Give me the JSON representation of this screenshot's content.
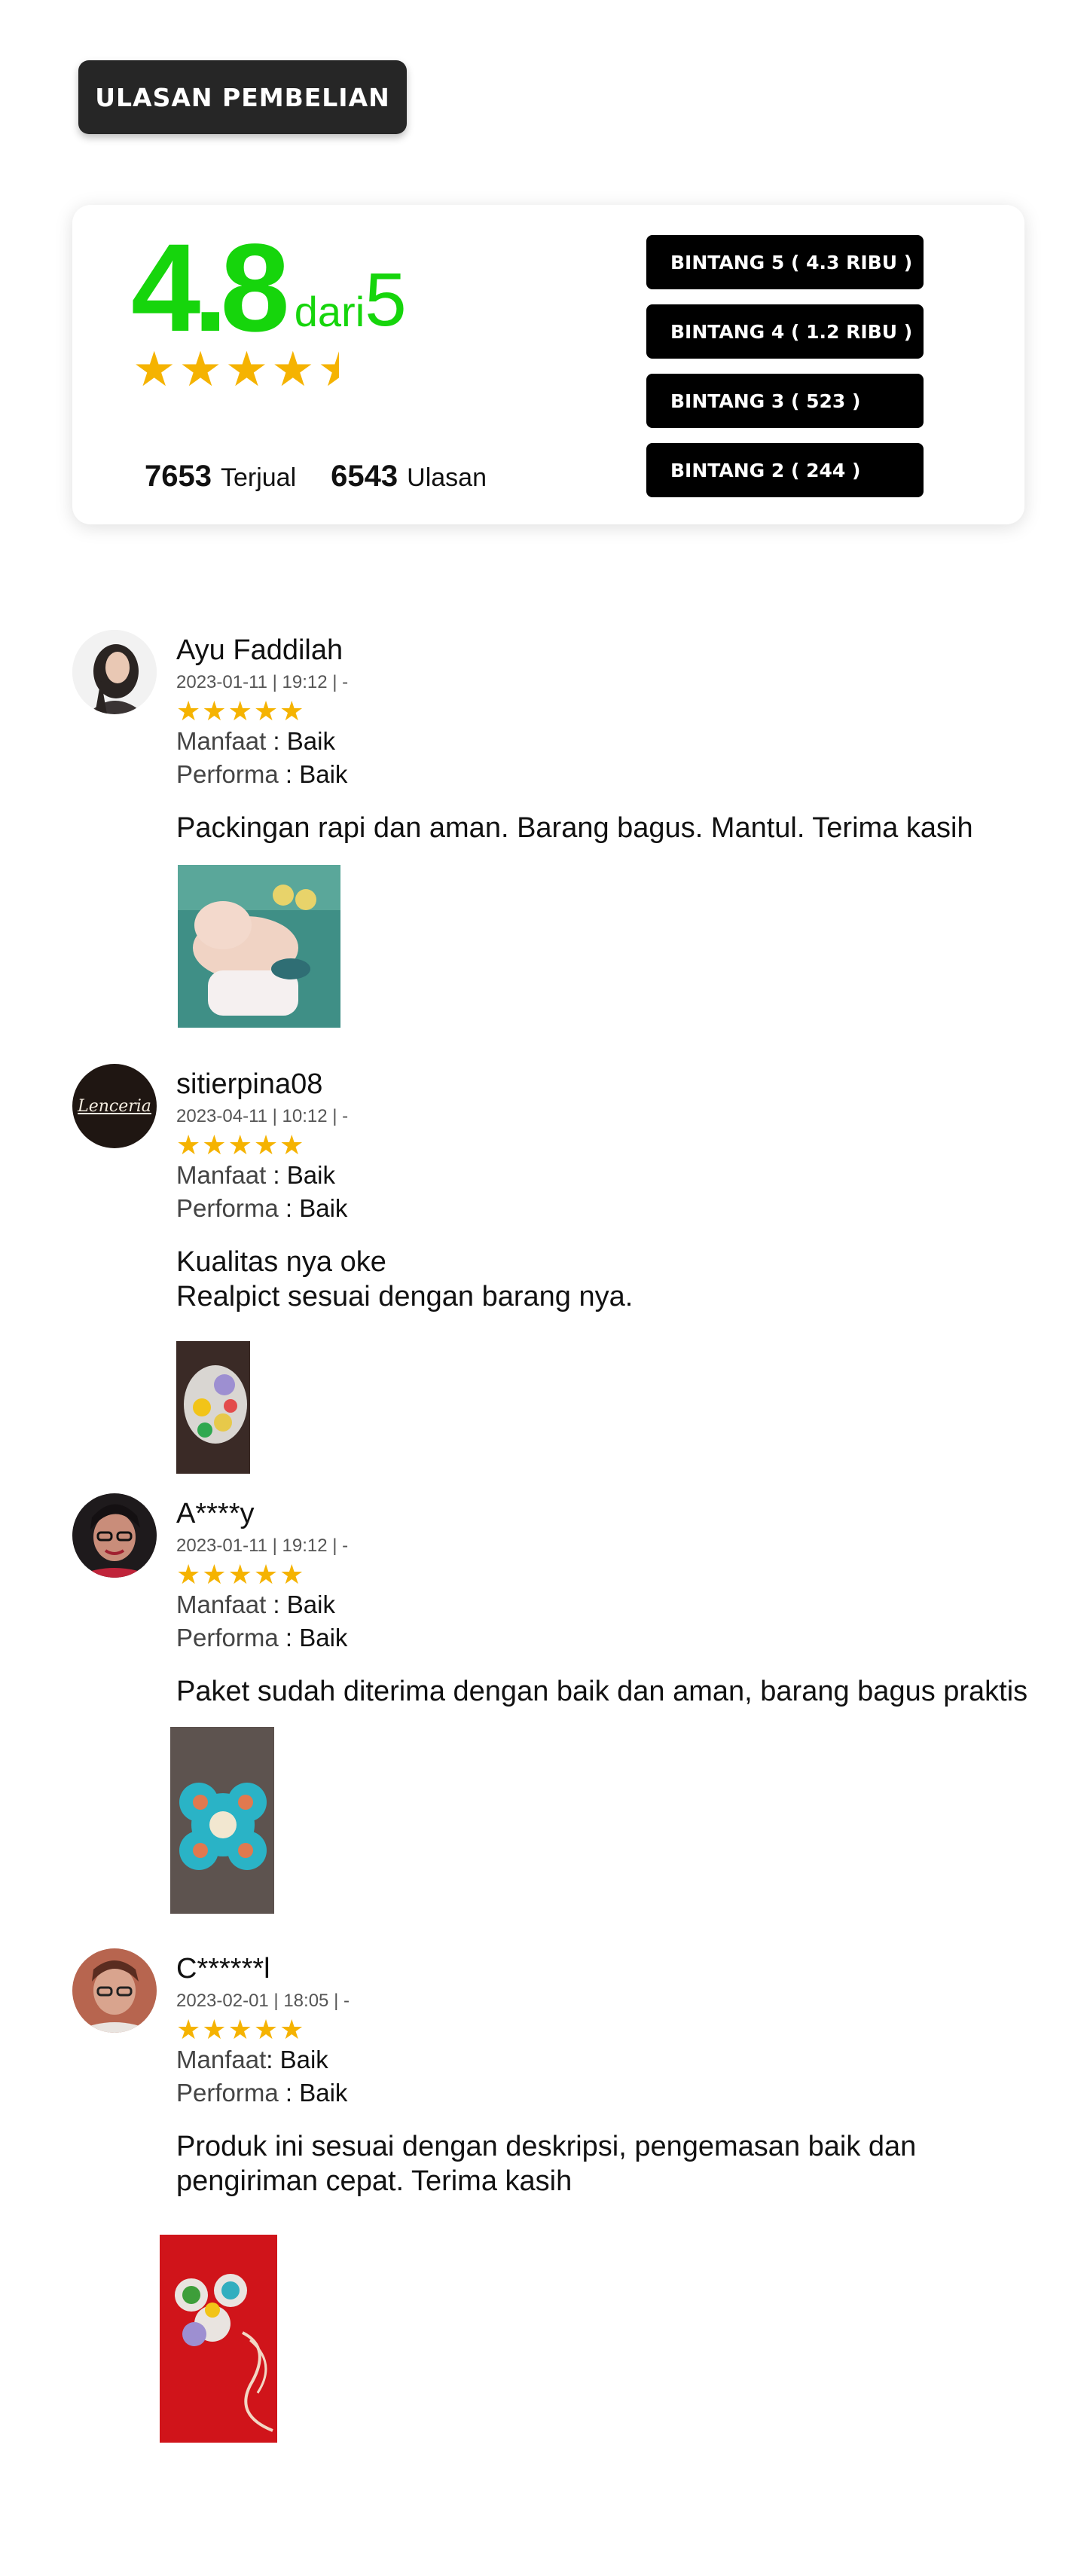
{
  "header": {
    "title": "ULASAN PEMBELIAN"
  },
  "summary": {
    "rating": "4.8",
    "of_label": "dari",
    "max_rating": "5",
    "stars_value": 4.5,
    "sold_count": "7653",
    "sold_label": "Terjual",
    "review_count": "6543",
    "review_label": "Ulasan",
    "filters": [
      {
        "label": "BINTANG 5 ( 4.3 RIBU )"
      },
      {
        "label": "BINTANG 4 ( 1.2 RIBU )"
      },
      {
        "label": "BINTANG 3 ( 523 )"
      },
      {
        "label": "BINTANG 2 ( 244 )"
      }
    ]
  },
  "star_glyph": "★",
  "colors": {
    "rating_green": "#16d50c",
    "star_gold": "#f5b301",
    "button_black": "#000000"
  },
  "reviews": [
    {
      "name": "Ayu Faddilah",
      "date": "2023-01-11 | 19:12 | -",
      "stars": 5,
      "manfaat_label": "Manfaat",
      "manfaat_sep": " : ",
      "manfaat_value": "Baik",
      "performa_label": "Performa",
      "performa_sep": " : ",
      "performa_value": "Baik",
      "text": "Packingan rapi dan aman. Barang bagus. Mantul. Terima kasih"
    },
    {
      "name": "sitierpina08",
      "date": "2023-04-11 | 10:12 | -",
      "stars": 5,
      "manfaat_label": "Manfaat",
      "manfaat_sep": " : ",
      "manfaat_value": "Baik",
      "performa_label": "Performa",
      "performa_sep": " : ",
      "performa_value": "Baik",
      "text": "Kualitas nya oke\nRealpict sesuai dengan barang nya.",
      "avatar_text": "Lenceria"
    },
    {
      "name": "A****y",
      "date": "2023-01-11 | 19:12 | -",
      "stars": 5,
      "manfaat_label": "Manfaat",
      "manfaat_sep": " : ",
      "manfaat_value": "Baik",
      "performa_label": "Performa",
      "performa_sep": " : ",
      "performa_value": "Baik",
      "text": "Paket sudah diterima dengan baik dan aman, barang bagus praktis"
    },
    {
      "name": "C******l",
      "date": "2023-02-01 | 18:05 | -",
      "stars": 5,
      "manfaat_label": "Manfaat",
      "manfaat_sep": ": ",
      "manfaat_value": "Baik",
      "performa_label": "Performa",
      "performa_sep": " : ",
      "performa_value": "Baik",
      "text": "Produk ini sesuai dengan deskripsi, pengemasan baik dan pengiriman cepat. Terima kasih"
    }
  ]
}
